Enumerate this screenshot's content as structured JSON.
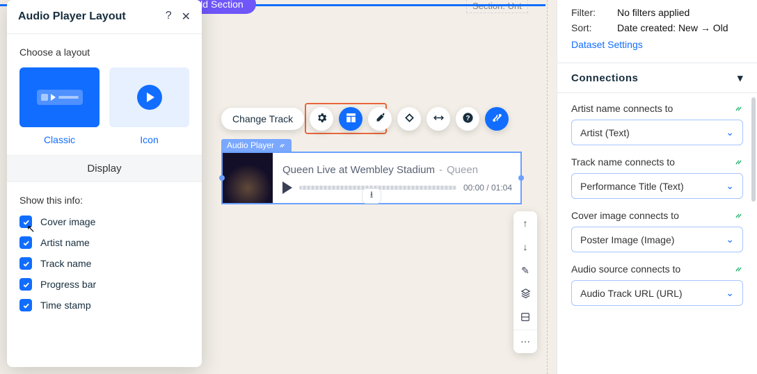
{
  "panel": {
    "title": "Audio Player Layout",
    "choose_label": "Choose a layout",
    "layouts": {
      "classic": "Classic",
      "icon": "Icon"
    },
    "display_header": "Display",
    "show_label": "Show this info:",
    "checks": {
      "cover": "Cover image",
      "artist": "Artist name",
      "track": "Track name",
      "progress": "Progress bar",
      "time": "Time stamp"
    }
  },
  "canvas": {
    "add_section": "Add Section",
    "crumb": "Section: Unt",
    "change_track": "Change Track",
    "player_tag": "Audio Player",
    "player": {
      "title": "Queen Live at Wembley Stadium",
      "artist": "Queen",
      "time": "00:00 / 01:04"
    }
  },
  "inspector": {
    "filter_k": "Filter:",
    "filter_v": "No filters applied",
    "sort_k": "Sort:",
    "sort_v": "Date created: New → Old",
    "dataset_link": "Dataset Settings",
    "connections_header": "Connections",
    "conns": [
      {
        "label": "Artist name connects to",
        "value": "Artist (Text)"
      },
      {
        "label": "Track name connects to",
        "value": "Performance Title (Text)"
      },
      {
        "label": "Cover image connects to",
        "value": "Poster Image (Image)"
      },
      {
        "label": "Audio source connects to",
        "value": "Audio Track URL (URL)"
      }
    ]
  },
  "colors": {
    "accent": "#116dff",
    "highlight": "#e8663b"
  }
}
